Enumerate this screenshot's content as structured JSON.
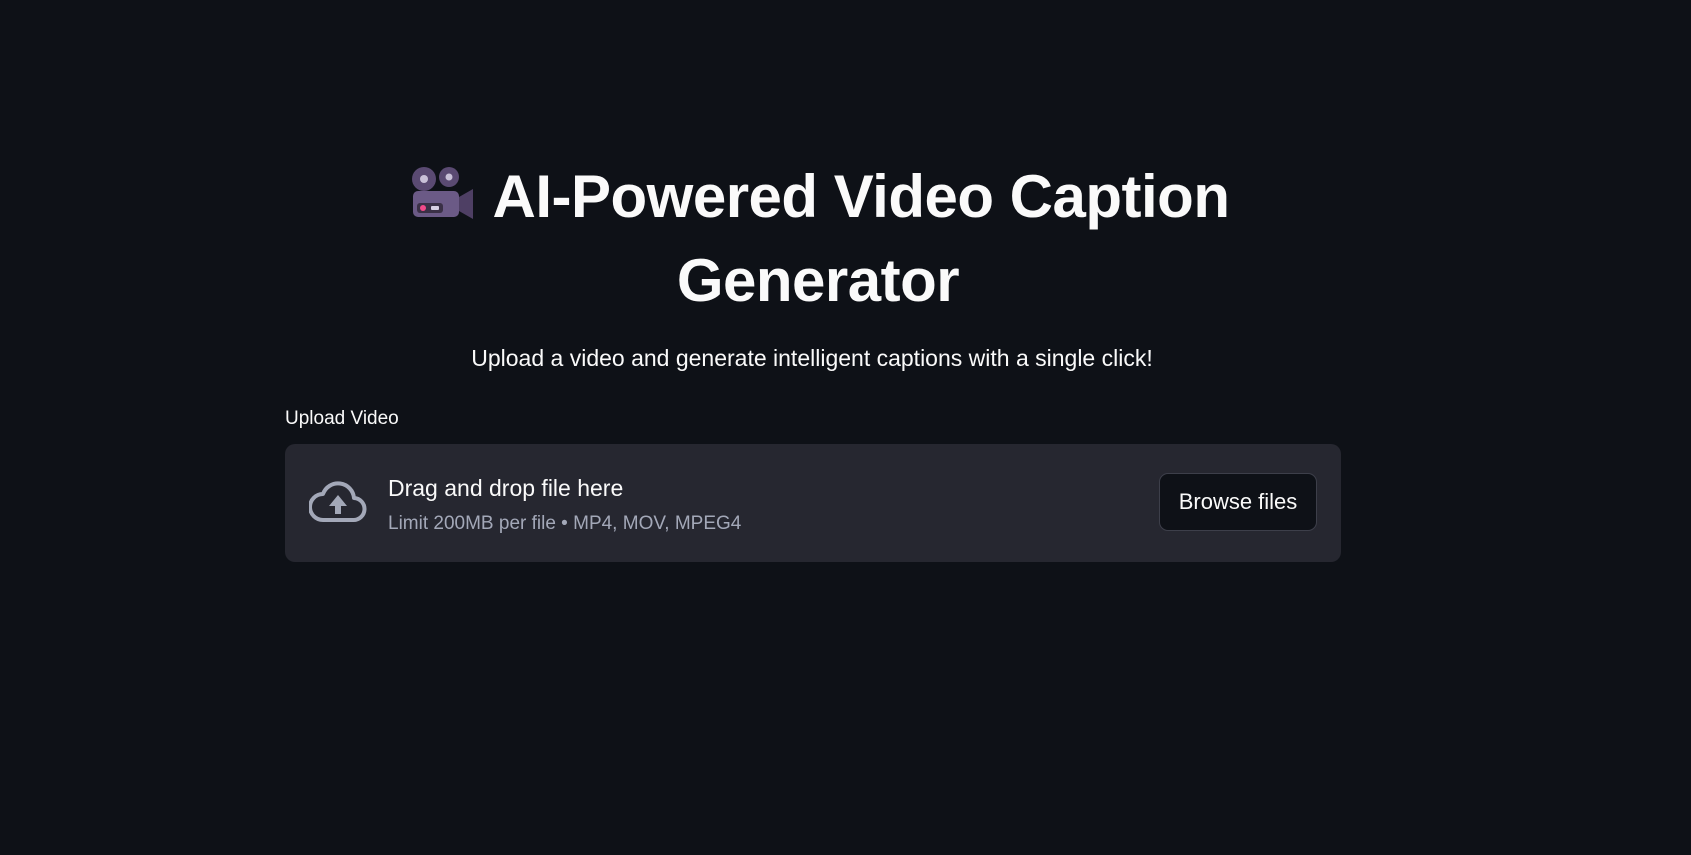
{
  "header": {
    "title": "AI-Powered Video Caption Generator",
    "title_icon": "movie-camera-icon",
    "subtitle": "Upload a video and generate intelligent captions with a single click!"
  },
  "uploader": {
    "label": "Upload Video",
    "icon": "cloud-upload-icon",
    "drop_text": "Drag and drop file here",
    "limit_text": "Limit 200MB per file • MP4, MOV, MPEG4",
    "browse_label": "Browse files"
  },
  "colors": {
    "background": "#0e1117",
    "dropzone": "#262730",
    "text": "#fafafa",
    "muted_text": "#a3a8b8"
  }
}
